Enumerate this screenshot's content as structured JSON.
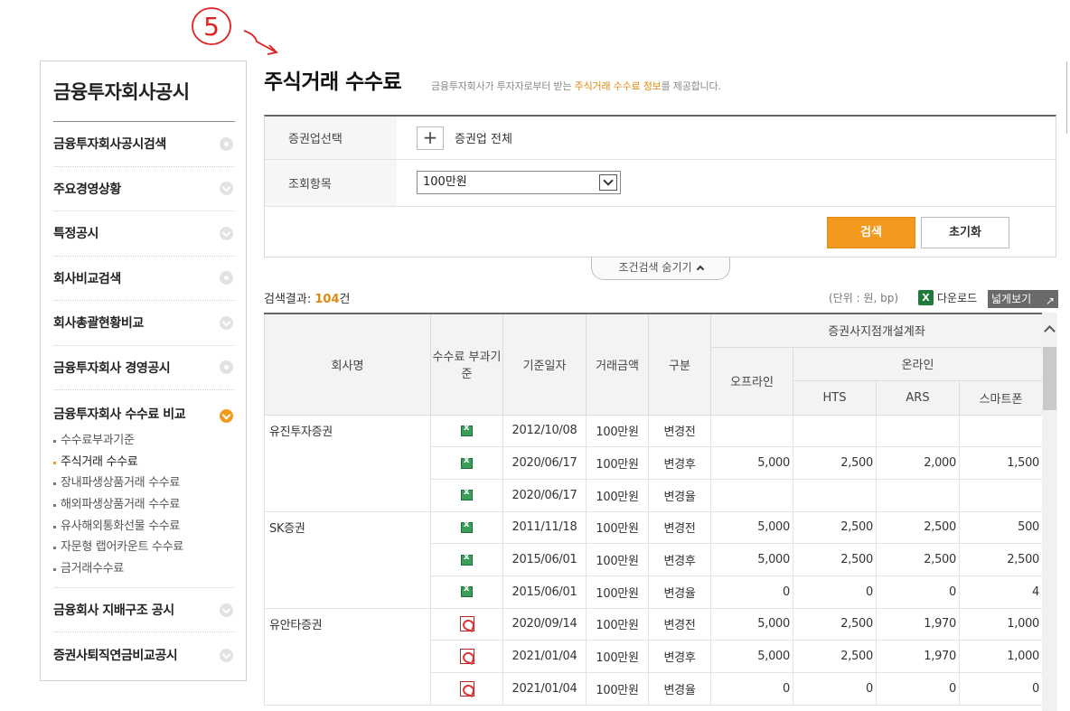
{
  "annotation": {
    "label": "5"
  },
  "sidebar": {
    "title": "금융투자회사공시",
    "items": [
      {
        "label": "금융투자회사공시검색",
        "icon": "dot-circle-icon"
      },
      {
        "label": "주요경영상황",
        "icon": "chevron-down-icon"
      },
      {
        "label": "특정공시",
        "icon": "chevron-down-icon"
      },
      {
        "label": "회사비교검색",
        "icon": "dot-circle-icon"
      },
      {
        "label": "회사총괄현황비교",
        "icon": "chevron-down-icon"
      },
      {
        "label": "금융투자회사 경영공시",
        "icon": "dot-circle-icon"
      },
      {
        "label": "금융투자회사 수수료 비교",
        "icon": "chevron-down-icon"
      }
    ],
    "subitems": [
      "수수료부과기준",
      "주식거래 수수료",
      "장내파생상품거래 수수료",
      "해외파생상품거래 수수료",
      "유사해외통화선물 수수료",
      "자문형 랩어카운트 수수료",
      "금거래수수료"
    ],
    "bottom_items": [
      {
        "label": "금융회사 지배구조 공시",
        "icon": "chevron-down-icon"
      },
      {
        "label": "증권사퇴직연금비교공시",
        "icon": "chevron-down-icon"
      }
    ]
  },
  "header": {
    "title": "주식거래 수수료",
    "desc_before": "금융투자회사가 투자자로부터 받는 ",
    "desc_highlight": "주식거래 수수료 정보",
    "desc_after": "를 제공합니다."
  },
  "filter": {
    "firm_label": "증권업선택",
    "plus": "+",
    "firm_value": "증권업 전체",
    "item_label": "조회항목",
    "item_value": "100만원",
    "search": "검색",
    "reset": "초기화",
    "toggle": "조건검색 숨기기"
  },
  "result": {
    "prefix": "검색결과: ",
    "count": "104",
    "suffix": "건",
    "unit": "(단위 : 원, bp)",
    "download": "다운로드",
    "wide_view": "넓게보기",
    "wide_arrow": "↗"
  },
  "table": {
    "headers": {
      "firm": "회사명",
      "basis": "수수료 부과기준",
      "date": "기준일자",
      "amount": "거래금액",
      "type": "구분",
      "group": "증권사지점개설계좌",
      "offline": "오프라인",
      "online": "온라인",
      "hts": "HTS",
      "ars": "ARS",
      "smartphone": "스마트폰"
    },
    "groups": [
      {
        "firm": "유진투자증권",
        "rows": [
          {
            "icon": "xls",
            "date": "2012/10/08",
            "amount": "100만원",
            "type": "변경전",
            "offline": "",
            "hts": "",
            "ars": "",
            "smart": ""
          },
          {
            "icon": "xls",
            "date": "2020/06/17",
            "amount": "100만원",
            "type": "변경후",
            "offline": "5,000",
            "hts": "2,500",
            "ars": "2,000",
            "smart": "1,500"
          },
          {
            "icon": "xls",
            "date": "2020/06/17",
            "amount": "100만원",
            "type": "변경율",
            "offline": "",
            "hts": "",
            "ars": "",
            "smart": ""
          }
        ]
      },
      {
        "firm": "SK증권",
        "rows": [
          {
            "icon": "xls",
            "date": "2011/11/18",
            "amount": "100만원",
            "type": "변경전",
            "offline": "5,000",
            "hts": "2,500",
            "ars": "2,500",
            "smart": "500"
          },
          {
            "icon": "xls",
            "date": "2015/06/01",
            "amount": "100만원",
            "type": "변경후",
            "offline": "5,000",
            "hts": "2,500",
            "ars": "2,500",
            "smart": "2,500"
          },
          {
            "icon": "xls",
            "date": "2015/06/01",
            "amount": "100만원",
            "type": "변경율",
            "offline": "0",
            "hts": "0",
            "ars": "0",
            "smart": "4"
          }
        ]
      },
      {
        "firm": "유안타증권",
        "rows": [
          {
            "icon": "pdf",
            "date": "2020/09/14",
            "amount": "100만원",
            "type": "변경전",
            "offline": "5,000",
            "hts": "2,500",
            "ars": "1,970",
            "smart": "1,000"
          },
          {
            "icon": "pdf",
            "date": "2021/01/04",
            "amount": "100만원",
            "type": "변경후",
            "offline": "5,000",
            "hts": "2,500",
            "ars": "1,970",
            "smart": "1,000"
          },
          {
            "icon": "pdf",
            "date": "2021/01/04",
            "amount": "100만원",
            "type": "변경율",
            "offline": "0",
            "hts": "0",
            "ars": "0",
            "smart": "0"
          }
        ]
      }
    ]
  },
  "colors": {
    "accent": "#f39a1e",
    "annotation": "#e02020",
    "highlight": "#e08a10"
  }
}
